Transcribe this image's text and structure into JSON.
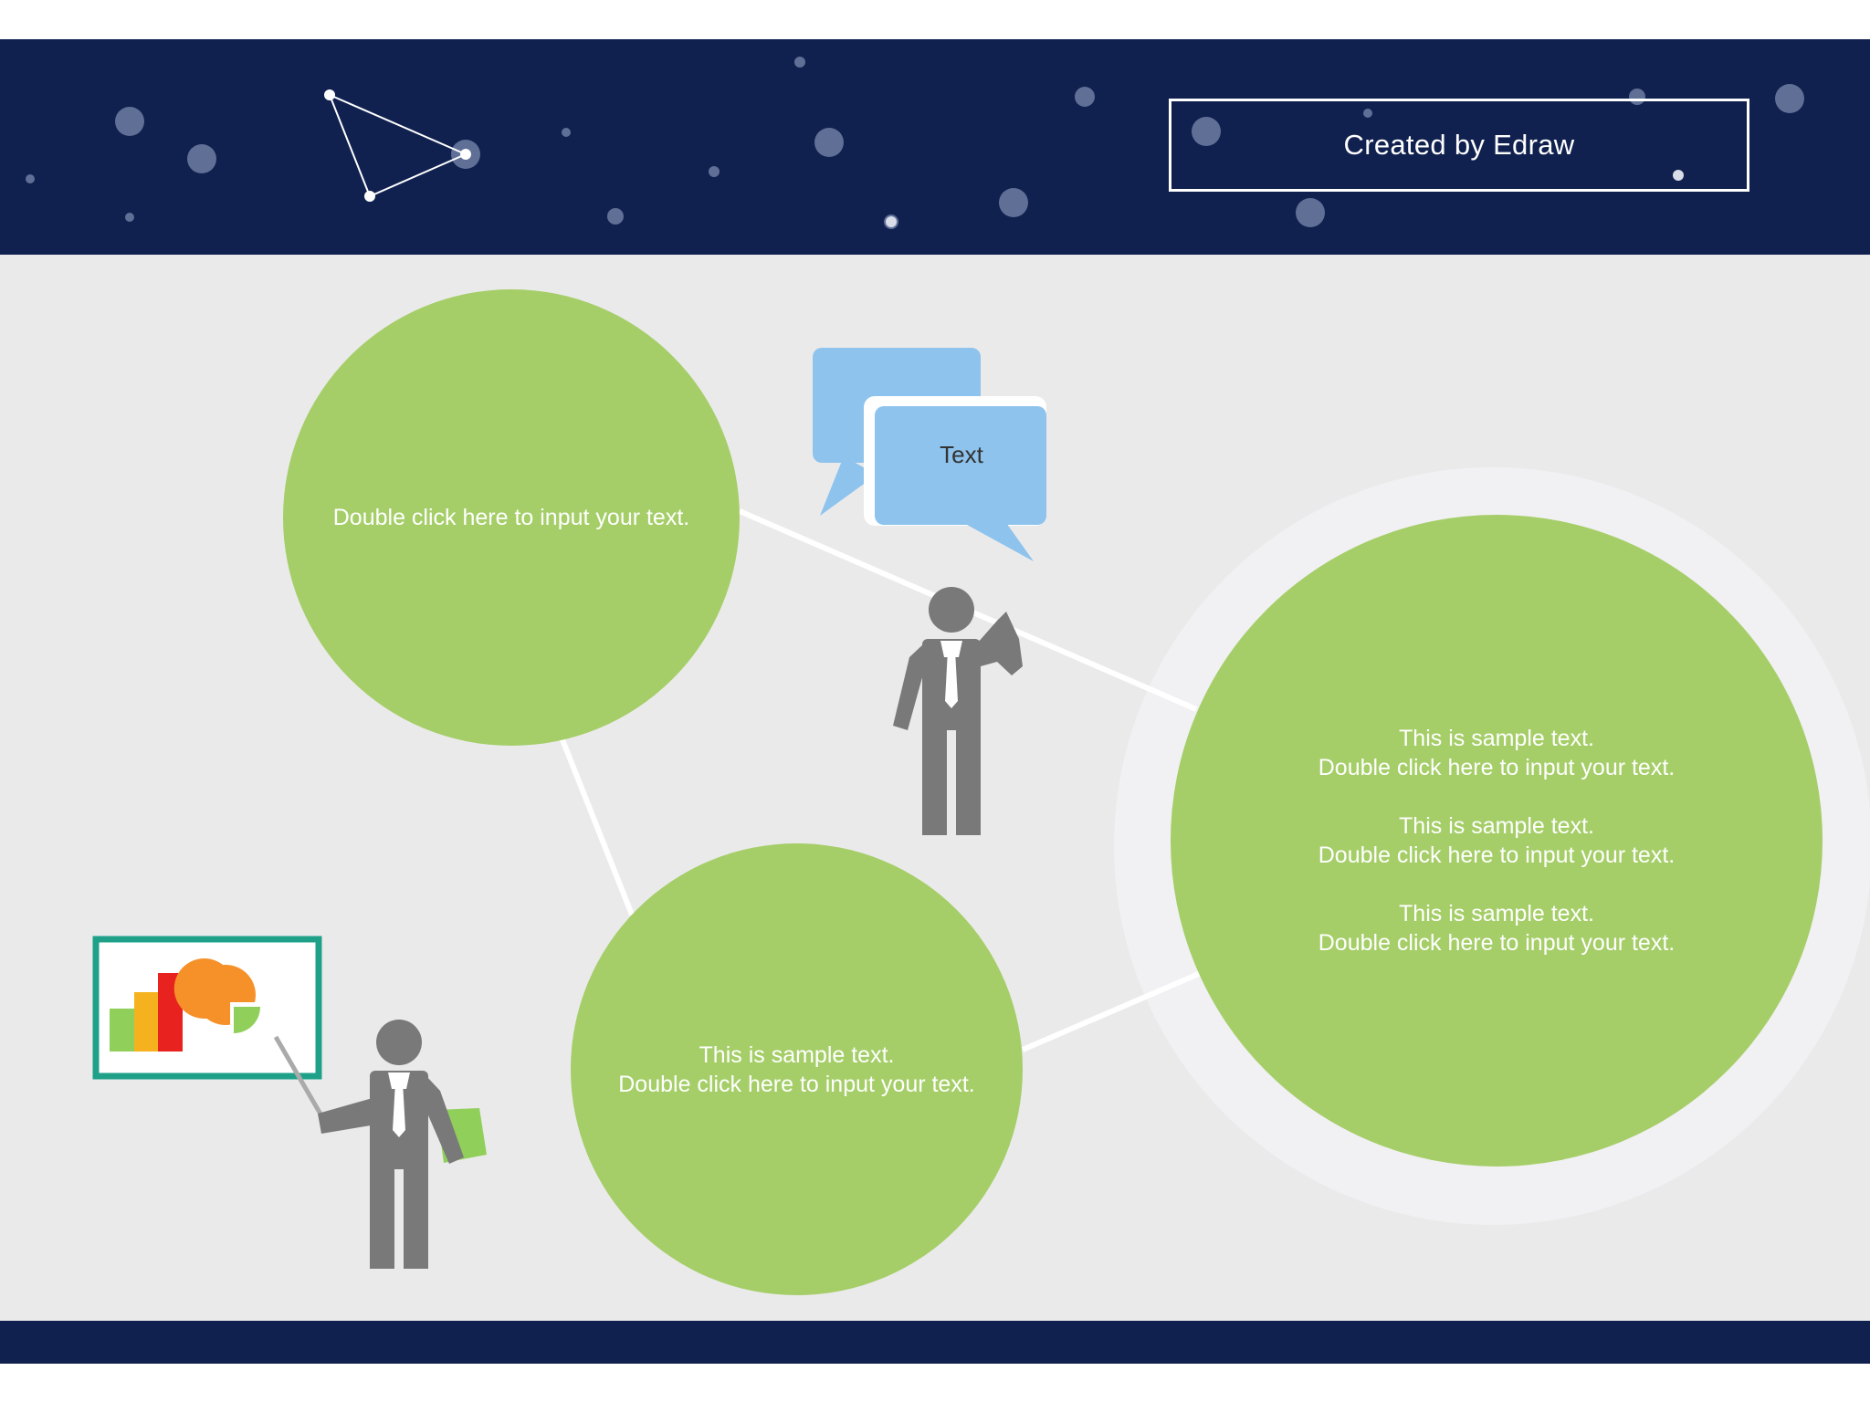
{
  "header": {
    "badge_text": "Created by Edraw"
  },
  "colors": {
    "navy": "#10214f",
    "background": "#ebeaeb",
    "circle_green": "#a5ce68",
    "bubble_blue": "#8dc3ec",
    "person_gray": "#7a7979",
    "board_border": "#1ea188"
  },
  "bubble": {
    "text": "Text"
  },
  "circles": {
    "top_left": {
      "lines": [
        "Double click here to input your text."
      ]
    },
    "bottom_center": {
      "lines": [
        "This is sample text.",
        "Double click here to input your text."
      ]
    },
    "right": {
      "paragraphs": [
        {
          "line1": "This is sample text.",
          "line2": "Double click here to input your text."
        },
        {
          "line1": "This is sample text.",
          "line2": "Double click here to input your text."
        },
        {
          "line1": "This is sample text.",
          "line2": "Double click here to input your text."
        }
      ]
    }
  },
  "icons": {
    "constellation": "constellation-icon",
    "speech_bubbles": "speech-bubbles-icon",
    "thinking_person": "thinking-businessman-icon",
    "presenter": "presenter-businessman-icon",
    "presentation_board": "presentation-board-icon"
  }
}
